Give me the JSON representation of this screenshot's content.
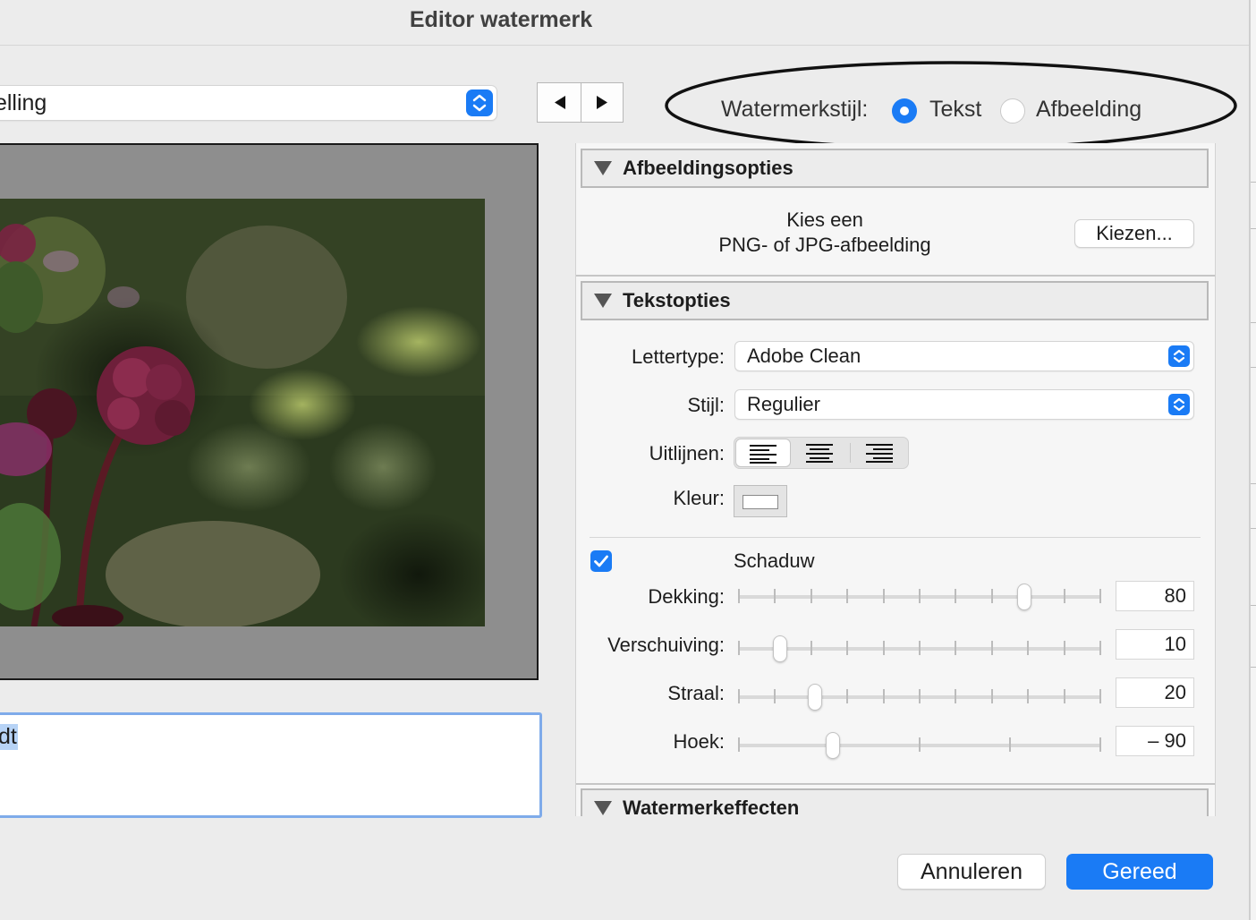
{
  "window": {
    "title": "Editor watermerk"
  },
  "preset": {
    "value": "telling"
  },
  "watermark_style": {
    "label": "Watermerkstijl:",
    "options": [
      {
        "label": "Tekst",
        "selected": true
      },
      {
        "label": "Afbeelding",
        "selected": false
      }
    ]
  },
  "text_input": {
    "value": "dt"
  },
  "image_options": {
    "title": "Afbeeldingsopties",
    "hint_line1": "Kies een",
    "hint_line2": "PNG- of JPG-afbeelding",
    "choose_button": "Kiezen..."
  },
  "text_options": {
    "title": "Tekstopties",
    "font": {
      "label": "Lettertype:",
      "value": "Adobe Clean"
    },
    "style": {
      "label": "Stijl:",
      "value": "Regulier"
    },
    "align": {
      "label": "Uitlijnen:",
      "selected": "left"
    },
    "color": {
      "label": "Kleur:",
      "value": "#ffffff"
    },
    "shadow": {
      "label": "Schaduw",
      "checked": true,
      "opacity": {
        "label": "Dekking:",
        "value": "80",
        "fraction": 0.8
      },
      "offset": {
        "label": "Verschuiving:",
        "value": "10",
        "fraction": 0.1
      },
      "radius": {
        "label": "Straal:",
        "value": "20",
        "fraction": 0.2
      },
      "angle": {
        "label": "Hoek:",
        "value": "– 90",
        "fraction": 0.25
      }
    }
  },
  "effects": {
    "title": "Watermerkeffecten"
  },
  "buttons": {
    "cancel": "Annuleren",
    "done": "Gereed"
  },
  "colors": {
    "accent": "#1a7bf5",
    "focus_ring": "#7fabea"
  }
}
